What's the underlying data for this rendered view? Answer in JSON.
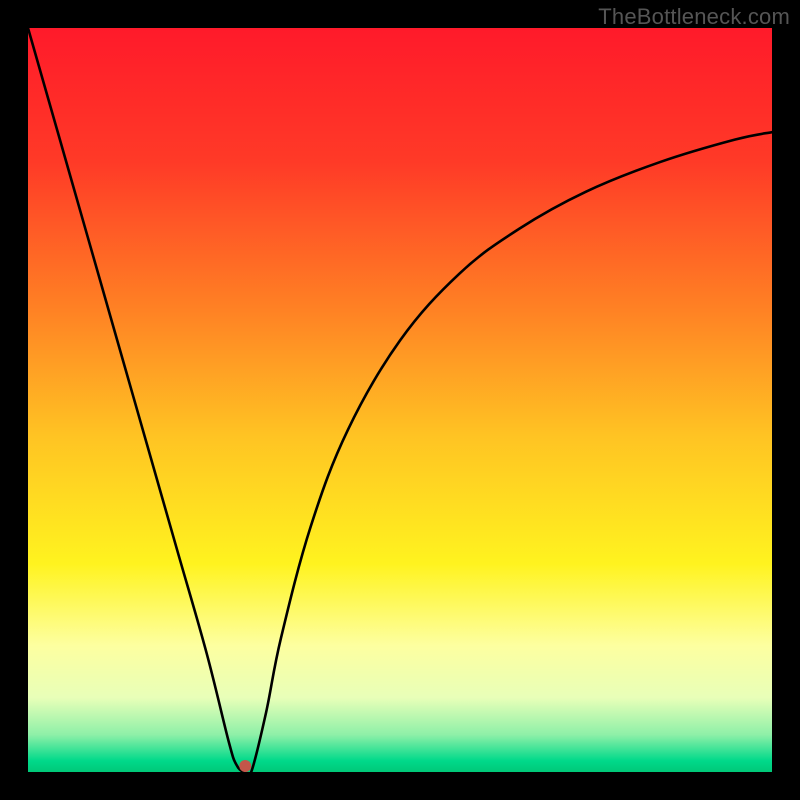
{
  "watermark": "TheBottleneck.com",
  "chart_data": {
    "type": "line",
    "title": "",
    "xlabel": "",
    "ylabel": "",
    "xlim": [
      0,
      100
    ],
    "ylim": [
      0,
      100
    ],
    "grid": false,
    "series": [
      {
        "name": "bottleneck-curve",
        "x": [
          0,
          4,
          8,
          12,
          16,
          20,
          24,
          27,
          28,
          29,
          30,
          32,
          34,
          38,
          43,
          50,
          58,
          66,
          75,
          85,
          95,
          100
        ],
        "values": [
          100,
          86,
          72,
          58,
          44,
          30,
          16,
          4,
          1,
          0,
          0,
          8,
          18,
          33,
          46,
          58,
          67,
          73,
          78,
          82,
          85,
          86
        ]
      }
    ],
    "markers": [
      {
        "name": "min-point",
        "x": 29.2,
        "y": 0.8,
        "color": "#c4564a",
        "r": 6
      }
    ],
    "gradient_stops": [
      {
        "offset": 0.0,
        "color": "#ff1a2a"
      },
      {
        "offset": 0.18,
        "color": "#ff3a27"
      },
      {
        "offset": 0.38,
        "color": "#ff8224"
      },
      {
        "offset": 0.55,
        "color": "#ffc423"
      },
      {
        "offset": 0.72,
        "color": "#fff31f"
      },
      {
        "offset": 0.83,
        "color": "#fdffa0"
      },
      {
        "offset": 0.9,
        "color": "#e8ffb8"
      },
      {
        "offset": 0.95,
        "color": "#8ef0a8"
      },
      {
        "offset": 0.985,
        "color": "#00d98a"
      },
      {
        "offset": 1.0,
        "color": "#00c878"
      }
    ]
  }
}
